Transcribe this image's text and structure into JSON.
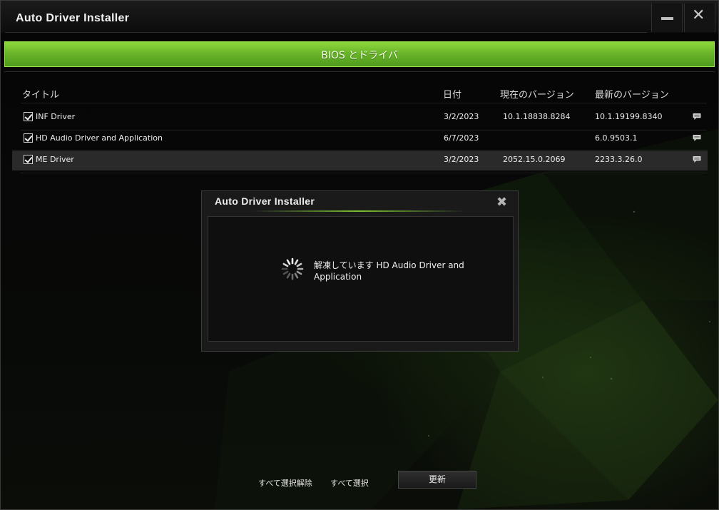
{
  "window": {
    "title": "Auto Driver Installer",
    "minimize_icon": "minimize-icon",
    "close_icon": "close-icon"
  },
  "category_header": "BIOS とドライバ",
  "table": {
    "columns": [
      "タイトル",
      "日付",
      "現在のバージョン",
      "最新のバージョン"
    ],
    "rows": [
      {
        "checked": true,
        "title": "INF Driver",
        "date": "3/2/2023",
        "current": "10.1.18838.8284",
        "latest": "10.1.19199.8340",
        "icon": "comment-icon"
      },
      {
        "checked": true,
        "title": "HD Audio Driver and Application",
        "date": "6/7/2023",
        "current": "",
        "latest": "6.0.9503.1",
        "icon": "comment-icon"
      },
      {
        "checked": true,
        "title": "ME Driver",
        "date": "3/2/2023",
        "current": "2052.15.0.2069",
        "latest": "2233.3.26.0",
        "icon": "comment-icon"
      }
    ]
  },
  "dialog": {
    "title": "Auto Driver Installer",
    "close_icon": "close-icon",
    "spinner_icon": "spinner-icon",
    "message_line1": "解凍しています HD Audio Driver and",
    "message_line2": "Application"
  },
  "footer": {
    "deselect_all": "すべて選択解除",
    "select_all": "すべて選択",
    "update": "更新"
  },
  "colors": {
    "accent_green": "#6ab52a",
    "background": "#000000",
    "selected_row": "#2a2a2a"
  }
}
